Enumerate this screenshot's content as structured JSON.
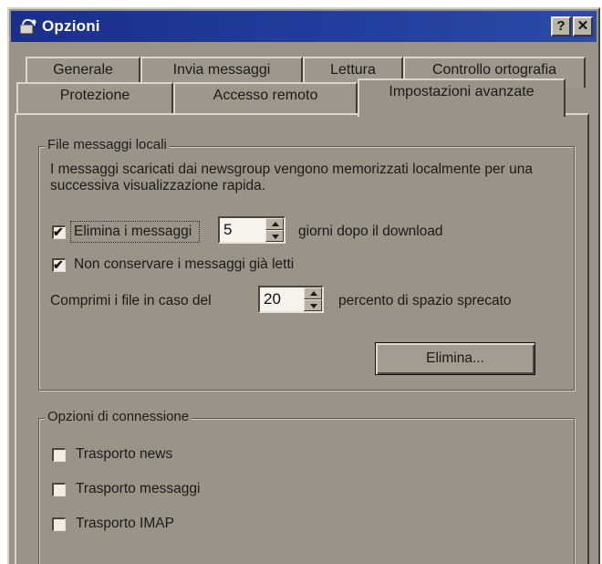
{
  "window": {
    "title": "Opzioni",
    "help_glyph": "?",
    "close_glyph": "✕",
    "title_icon": "newsgroup-app-icon"
  },
  "tabs_row1": [
    {
      "label": "Generale"
    },
    {
      "label": "Invia messaggi"
    },
    {
      "label": "Lettura"
    },
    {
      "label": "Controllo ortografia"
    }
  ],
  "tabs_row2": [
    {
      "label": "Protezione"
    },
    {
      "label": "Accesso remoto"
    },
    {
      "label": "Impostazioni avanzate",
      "active": true
    }
  ],
  "local_files": {
    "group_label": "File messaggi locali",
    "description": "I messaggi scaricati dai newsgroup vengono memorizzati localmente per una successiva visualizzazione rapida.",
    "delete_checkbox_label": "Elimina i messaggi",
    "delete_checked": true,
    "delete_days_value": "5",
    "delete_days_suffix": "giorni dopo il download",
    "keep_read_label": "Non conservare i messaggi già letti",
    "keep_read_checked": true,
    "compress_label": "Comprimi i file in caso del",
    "compress_value": "20",
    "compress_suffix": "percento di spazio sprecato",
    "delete_button": "Elimina..."
  },
  "connection": {
    "group_label": "Opzioni di connessione",
    "options": [
      {
        "label": "Trasporto news",
        "checked": false
      },
      {
        "label": "Trasporto messaggi",
        "checked": false
      },
      {
        "label": "Trasporto IMAP",
        "checked": false
      }
    ]
  },
  "colors": {
    "titlebar": "#1a2f8a",
    "dialog_face": "#9a9488"
  }
}
